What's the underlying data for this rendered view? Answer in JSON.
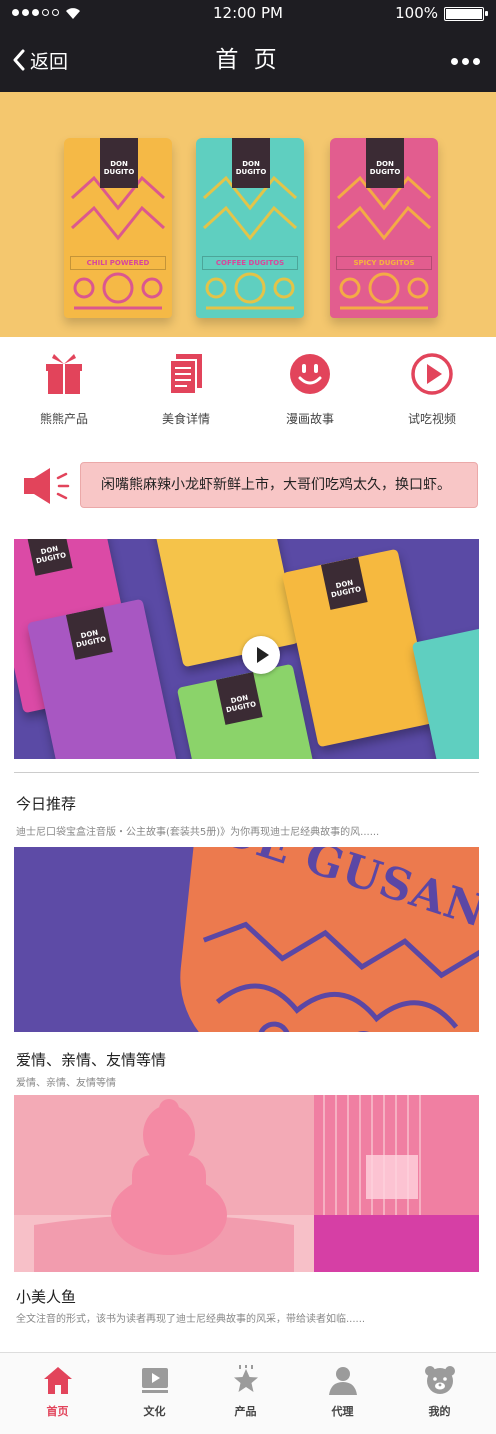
{
  "status_bar": {
    "time": "12:00 PM",
    "battery": "100%"
  },
  "nav": {
    "back_label": "返回",
    "title": "首 页"
  },
  "hero": {
    "packs": [
      {
        "brand": "DON DUGITO",
        "band": "CHILI POWERED",
        "color": "#f5b946",
        "accent": "#d7479c"
      },
      {
        "brand": "DON DUGITO",
        "band": "COFFEE DUGITOS",
        "color": "#5fcfc0",
        "accent": "#f2c23c"
      },
      {
        "brand": "DON DUGITO",
        "band": "SPICY DUGITOS",
        "color": "#e25d8f",
        "accent": "#f6b43d"
      }
    ]
  },
  "icons": [
    {
      "label": "熊熊产品",
      "icon": "gift-icon"
    },
    {
      "label": "美食详情",
      "icon": "document-icon"
    },
    {
      "label": "漫画故事",
      "icon": "smiley-icon"
    },
    {
      "label": "试吃视频",
      "icon": "play-circle-icon"
    }
  ],
  "notice": {
    "text": "闲嘴熊麻辣小龙虾新鲜上市，大哥们吃鸡太久，换口虾。"
  },
  "video": {
    "packs": [
      {
        "brand": "DON DUGITO",
        "color": "#db4aa6"
      },
      {
        "brand": "DON DUGITO",
        "color": "#f5c34a"
      },
      {
        "brand": "DON DUGITO",
        "color": "#f6b93f"
      },
      {
        "brand": "DON DUGITO",
        "color": "#a857c2"
      },
      {
        "brand": "DON DUGITO",
        "color": "#8bd36a"
      },
      {
        "brand": "DON DUGITO",
        "color": "#5fcfc0"
      }
    ]
  },
  "sections": [
    {
      "title": "今日推荐",
      "desc": "迪士尼口袋宝盒注音版・公主故事(套装共5册)》为你再现迪士尼经典故事的风......"
    },
    {
      "title": "爱情、亲情、友情等情",
      "desc": "爱情、亲情、友情等情"
    },
    {
      "title": "小美人鱼",
      "desc": "全文注音的形式，该书为读者再现了迪士尼经典故事的风采，带给读者如临......"
    }
  ],
  "card1": {
    "bag_text": "DE GUSANO"
  },
  "tabs": [
    {
      "label": "首页",
      "icon": "home-icon",
      "active": true
    },
    {
      "label": "文化",
      "icon": "video-icon",
      "active": false
    },
    {
      "label": "产品",
      "icon": "star-icon",
      "active": false
    },
    {
      "label": "代理",
      "icon": "user-icon",
      "active": false
    },
    {
      "label": "我的",
      "icon": "bear-icon",
      "active": false
    }
  ],
  "colors": {
    "accent": "#e2445b",
    "dark_bar": "#1e1d22",
    "notice_bg": "#f8c6c6"
  }
}
